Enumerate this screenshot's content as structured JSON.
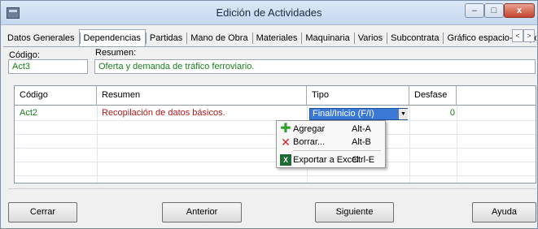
{
  "window": {
    "title": "Edición de Actividades"
  },
  "window_controls": {
    "minimize": "–",
    "maximize": "□",
    "close": "x"
  },
  "tabs": [
    {
      "label": "Datos Generales"
    },
    {
      "label": "Dependencias",
      "active": true
    },
    {
      "label": "Partidas"
    },
    {
      "label": "Mano de Obra"
    },
    {
      "label": "Materiales"
    },
    {
      "label": "Maquinaria"
    },
    {
      "label": "Varios"
    },
    {
      "label": "Subcontrata"
    },
    {
      "label": "Gráfico espacio-tiempo"
    }
  ],
  "tab_scroll": {
    "left": "<",
    "right": ">"
  },
  "form": {
    "codigo_label": "Código:",
    "codigo_value": "Act3",
    "resumen_label": "Resumen:",
    "resumen_value": "Oferta y demanda de tráfico ferroviario."
  },
  "grid": {
    "columns": [
      "Código",
      "Resumen",
      "Tipo",
      "Desfase"
    ],
    "rows": [
      {
        "codigo": "Act2",
        "resumen": "Recopilación de datos básicos.",
        "tipo": "Final/Inicio (F/I)",
        "desfase": "0"
      }
    ]
  },
  "context_menu": {
    "items": [
      {
        "icon": "plus-icon",
        "label": "Agregar",
        "shortcut": "Alt-A"
      },
      {
        "icon": "delete-x-icon",
        "label": "Borrar...",
        "shortcut": "Alt-B"
      },
      {
        "icon": "excel-icon",
        "label": "Exportar a Excel",
        "shortcut": "Ctrl-E"
      }
    ]
  },
  "buttons": {
    "cerrar": "Cerrar",
    "anterior": "Anterior",
    "siguiente": "Siguiente",
    "ayuda": "Ayuda"
  },
  "colors": {
    "value_green": "#1a7d1a",
    "value_red": "#b01818",
    "selection_blue": "#3a7ad6"
  }
}
